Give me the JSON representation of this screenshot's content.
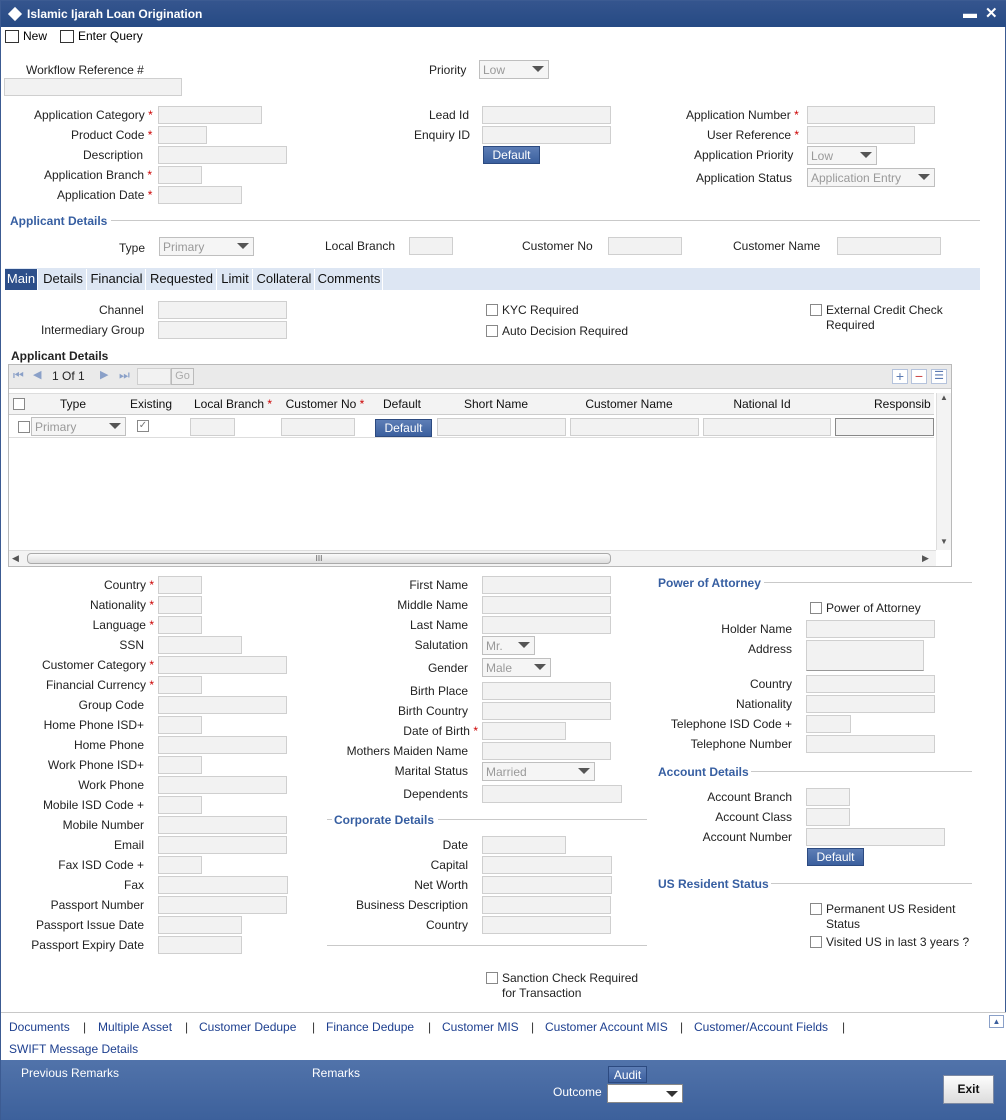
{
  "window": {
    "title": "Islamic Ijarah Loan Origination"
  },
  "toolbar": {
    "new": "New",
    "enter_query": "Enter Query"
  },
  "header": {
    "workflow_ref": "Workflow Reference #",
    "priority": "Priority",
    "priority_value": "Low",
    "app_category": "Application Category",
    "product_code": "Product Code",
    "description": "Description",
    "app_branch": "Application Branch",
    "app_date": "Application Date",
    "lead_id": "Lead Id",
    "enquiry_id": "Enquiry ID",
    "default_btn": "Default",
    "app_number": "Application Number",
    "user_ref": "User Reference",
    "app_priority": "Application Priority",
    "app_priority_value": "Low",
    "app_status": "Application Status",
    "app_status_value": "Application Entry",
    "req": "*"
  },
  "applicant": {
    "section": "Applicant Details",
    "type": "Type",
    "type_value": "Primary",
    "local_branch": "Local Branch",
    "customer_no": "Customer No",
    "customer_name": "Customer Name"
  },
  "tabs": [
    "Main",
    "Details",
    "Financial",
    "Requested",
    "Limit",
    "Collateral",
    "Comments"
  ],
  "main": {
    "channel": "Channel",
    "intermediary": "Intermediary Group",
    "kyc": "KYC Required",
    "auto_decision": "Auto Decision Required",
    "ext_credit1": "External Credit Check",
    "ext_credit2": "Required"
  },
  "grid": {
    "section": "Applicant Details",
    "page": "1 Of 1",
    "go": "Go",
    "headers": [
      "Type",
      "Existing",
      "Local Branch",
      "Customer No",
      "Default",
      "Short Name",
      "Customer Name",
      "National Id",
      "Responsib"
    ],
    "row": {
      "type": "Primary",
      "default_btn": "Default"
    },
    "scroll_grip": "III"
  },
  "left": {
    "country": "Country",
    "nationality": "Nationality",
    "language": "Language",
    "ssn": "SSN",
    "cust_category": "Customer Category",
    "fin_currency": "Financial Currency",
    "group_code": "Group Code",
    "home_isd": "Home Phone ISD+",
    "home_phone": "Home Phone",
    "work_isd": "Work Phone ISD+",
    "work_phone": "Work Phone",
    "mobile_isd": "Mobile ISD Code +",
    "mobile": "Mobile Number",
    "email": "Email",
    "fax_isd": "Fax ISD Code +",
    "fax": "Fax",
    "passport": "Passport Number",
    "passport_issue": "Passport Issue Date",
    "passport_expiry": "Passport Expiry Date"
  },
  "middle": {
    "first_name": "First Name",
    "middle_name": "Middle Name",
    "last_name": "Last Name",
    "salutation": "Salutation",
    "salutation_value": "Mr.",
    "gender": "Gender",
    "gender_value": "Male",
    "birth_place": "Birth Place",
    "birth_country": "Birth Country",
    "dob": "Date of Birth",
    "mothers_maiden": "Mothers Maiden Name",
    "marital": "Marital Status",
    "marital_value": "Married",
    "dependents": "Dependents"
  },
  "corporate": {
    "section": "Corporate Details",
    "date": "Date",
    "capital": "Capital",
    "net_worth": "Net Worth",
    "business_desc": "Business Description",
    "country": "Country",
    "sanction1": "Sanction Check Required",
    "sanction2": "for Transaction"
  },
  "poa": {
    "section": "Power of Attorney",
    "checkbox": "Power of Attorney",
    "holder": "Holder Name",
    "address": "Address",
    "country": "Country",
    "nationality": "Nationality",
    "tel_isd": "Telephone ISD Code +",
    "tel": "Telephone Number"
  },
  "account": {
    "section": "Account Details",
    "branch": "Account Branch",
    "class": "Account Class",
    "number": "Account Number",
    "default_btn": "Default"
  },
  "us": {
    "section": "US Resident Status",
    "perm1": "Permanent US Resident",
    "perm2": "Status",
    "visited": "Visited US in last 3 years ?"
  },
  "links": [
    "Documents",
    "Multiple Asset",
    "Customer Dedupe",
    "Finance Dedupe",
    "Customer MIS",
    "Customer Account MIS",
    "Customer/Account Fields",
    "SWIFT Message Details"
  ],
  "sep": "|",
  "footer": {
    "prev_remarks": "Previous Remarks",
    "remarks": "Remarks",
    "audit": "Audit",
    "outcome": "Outcome",
    "exit": "Exit"
  }
}
